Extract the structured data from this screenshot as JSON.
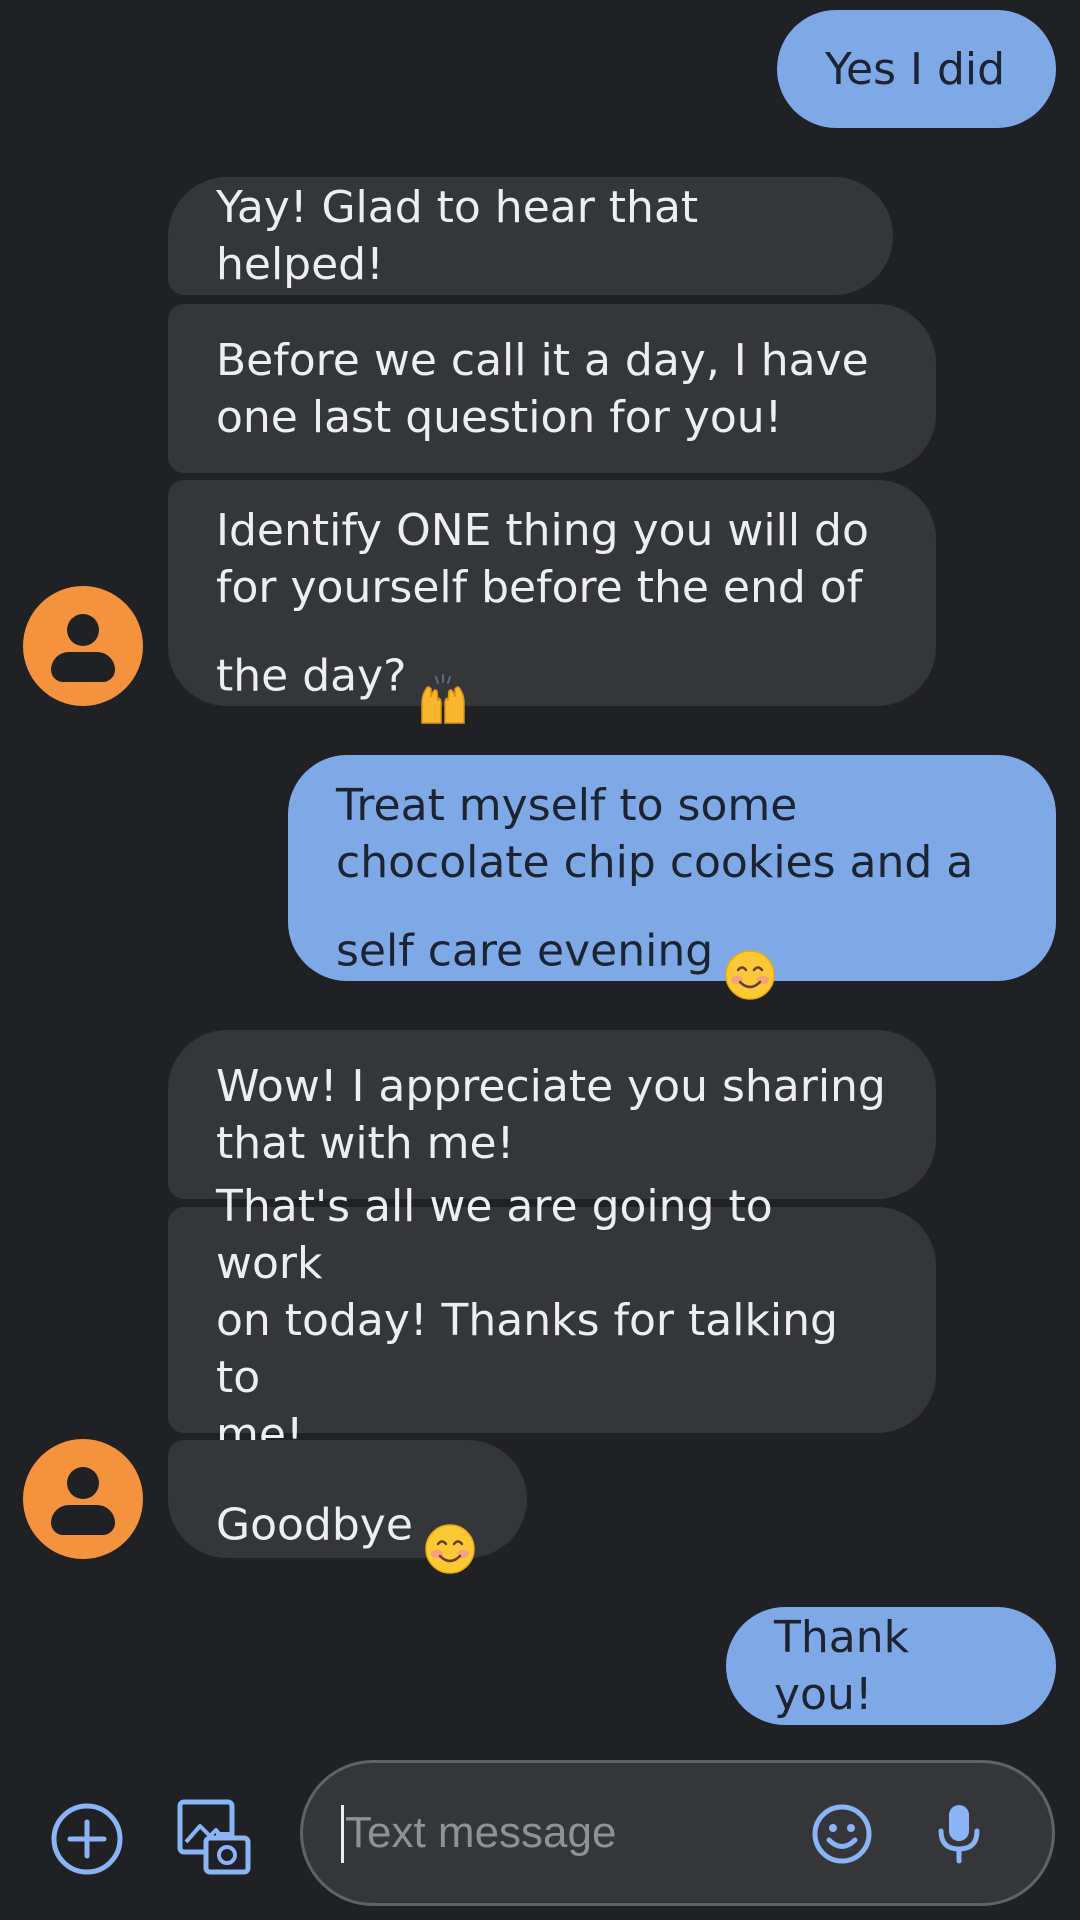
{
  "app": "Messages",
  "colors": {
    "background": "#202124",
    "incoming_bubble": "#35363a",
    "outgoing_bubble": "#7fa8e6",
    "avatar": "#f5923e",
    "accent": "#8ab4f8"
  },
  "messages": [
    {
      "direction": "outgoing",
      "text": "Yes I did"
    },
    {
      "direction": "incoming",
      "text": "Yay! Glad to hear that helped!"
    },
    {
      "direction": "incoming",
      "text": "Before we call it a day, I have\none last question for you!"
    },
    {
      "direction": "incoming",
      "text": "Identify ONE thing you will do\nfor yourself before the end of\nthe day?",
      "emoji": "raising-hands"
    },
    {
      "direction": "outgoing",
      "text": "Treat myself to some\nchocolate chip cookies and a\nself care evening",
      "emoji": "smiling-face"
    },
    {
      "direction": "incoming",
      "text": "Wow! I appreciate you sharing\nthat with me!"
    },
    {
      "direction": "incoming",
      "text": "That's all we are going to work\non today! Thanks for talking to\nme!"
    },
    {
      "direction": "incoming",
      "text": "Goodbye",
      "emoji": "smiling-face"
    },
    {
      "direction": "outgoing",
      "text": "Thank you!"
    }
  ],
  "compose": {
    "placeholder": "Text message",
    "icons": [
      "add-icon",
      "gallery-camera-icon",
      "emoji-icon",
      "mic-icon"
    ]
  }
}
